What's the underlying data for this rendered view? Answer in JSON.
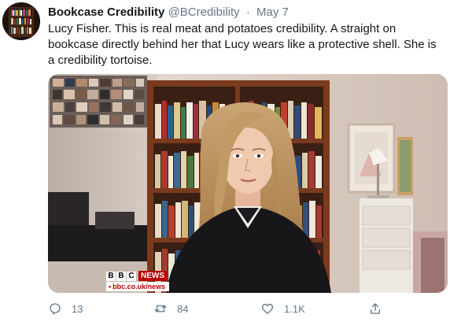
{
  "tweet": {
    "display_name": "Bookcase Credibility",
    "handle": "@BCredibility",
    "separator": "·",
    "date": "May 7",
    "text": "Lucy Fisher. This is real meat and potatoes credibility. A straight on bookcase directly behind her that Lucy wears like a protective shell. She is a credibility tortoise."
  },
  "media": {
    "bbc_letters": [
      "B",
      "B",
      "C"
    ],
    "bbc_news": "NEWS",
    "bbc_url_bullet": "•",
    "bbc_url": "bbc.co.uk/news"
  },
  "actions": {
    "reply_count": "13",
    "retweet_count": "84",
    "like_count": "1.1K"
  },
  "icons": [
    "reply-icon",
    "retweet-icon",
    "like-icon",
    "share-icon"
  ],
  "colors": {
    "bbc_red": "#b80000",
    "meta_gray": "#657786"
  }
}
